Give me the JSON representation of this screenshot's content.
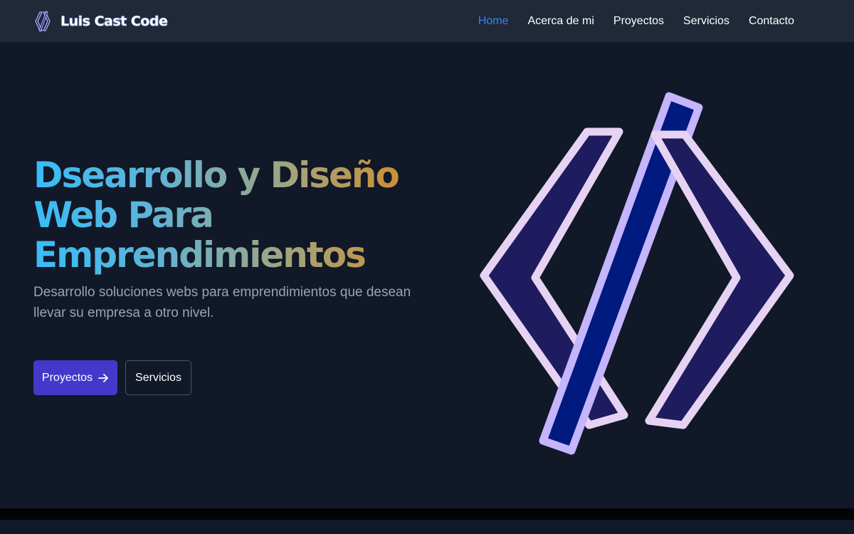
{
  "brand": {
    "name": "Luis Cast Code",
    "logo_icon": "code-brackets-logo-icon"
  },
  "nav": {
    "items": [
      {
        "label": "Home",
        "active": true
      },
      {
        "label": "Acerca de mi",
        "active": false
      },
      {
        "label": "Proyectos",
        "active": false
      },
      {
        "label": "Servicios",
        "active": false
      },
      {
        "label": "Contacto",
        "active": false
      }
    ]
  },
  "hero": {
    "title_lines": [
      "Dsearrollo y Diseño",
      "Web Para",
      "Emprendimientos"
    ],
    "description": "Desarrollo soluciones webs para emprendimientos que desean llevar su empresa a otro nivel.",
    "primary_button": {
      "label": "Proyectos",
      "icon": "arrow-right-icon"
    },
    "secondary_button": {
      "label": "Servicios"
    },
    "illustration_icon": "code-brackets-icon"
  },
  "colors": {
    "background": "#111827",
    "navbar": "#1f2937",
    "nav_active": "#3b82f6",
    "primary_button": "#4338ca",
    "gradient_start": "#38bdf8",
    "gradient_end": "#d9862a",
    "illustration_fill": "#1e1b5e",
    "illustration_slash": "#001a80",
    "illustration_outline": "#e6d3f3"
  }
}
